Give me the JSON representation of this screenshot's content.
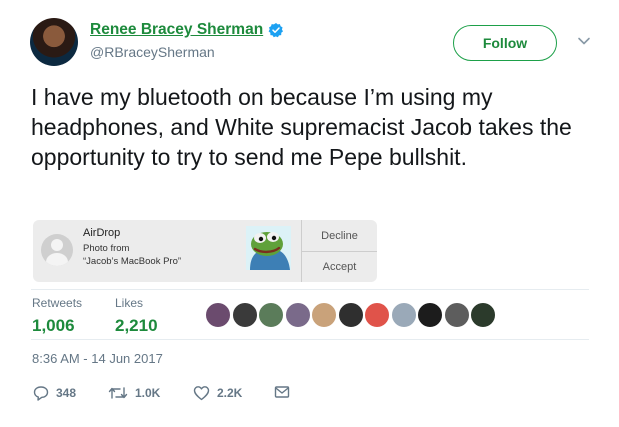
{
  "author": {
    "display_name": "Renee Bracey Sherman",
    "handle": "@RBraceySherman",
    "verified": true
  },
  "follow_button": {
    "label": "Follow"
  },
  "tweet": {
    "text": "I have my bluetooth on because I’m using my headphones, and White supremacist Jacob takes the opportunity to try to send me Pepe bullshit."
  },
  "airdrop": {
    "title": "AirDrop",
    "line1": "Photo from",
    "line2": "“Jacob’s MacBook Pro”",
    "decline_label": "Decline",
    "accept_label": "Accept"
  },
  "stats": {
    "retweets_label": "Retweets",
    "retweets_count": "1,006",
    "likes_label": "Likes",
    "likes_count": "2,210"
  },
  "likers": [
    {
      "color": "#6b4b6e"
    },
    {
      "color": "#3a3a3a"
    },
    {
      "color": "#5b7c5a"
    },
    {
      "color": "#7a6a8a"
    },
    {
      "color": "#c9a27a"
    },
    {
      "color": "#2f2f2f"
    },
    {
      "color": "#e0534a"
    },
    {
      "color": "#9aa9b8"
    },
    {
      "color": "#1c1c1c"
    },
    {
      "color": "#5d5d5d"
    },
    {
      "color": "#2b3a2b"
    }
  ],
  "timestamp": "8:36 AM - 14 Jun 2017",
  "actions": {
    "replies": "348",
    "retweets": "1.0K",
    "likes": "2.2K"
  },
  "colors": {
    "accent_green": "#1d8a3c",
    "verified_blue": "#1da1f2",
    "secondary_text": "#657786"
  }
}
